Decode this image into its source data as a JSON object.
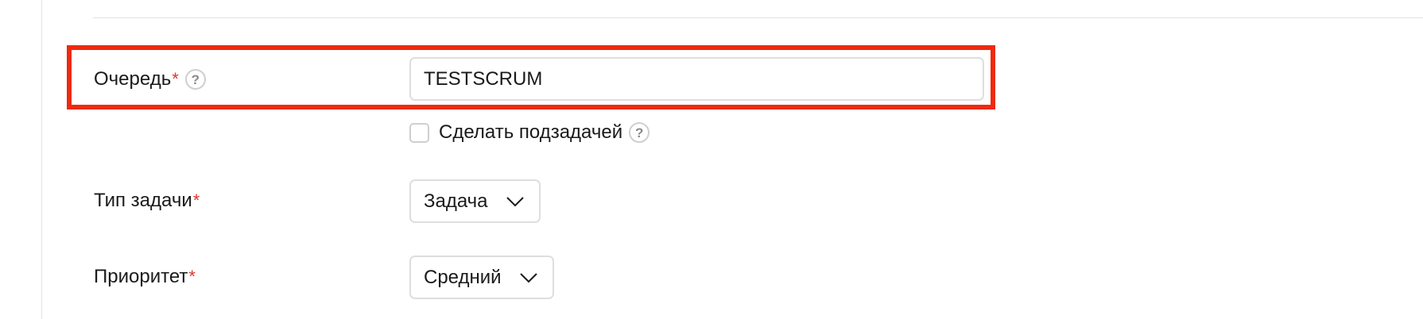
{
  "form": {
    "queue": {
      "label": "Очередь",
      "required_mark": "*",
      "help": "?",
      "value": "TESTSCRUM"
    },
    "subtask": {
      "label": "Сделать подзадачей",
      "help": "?",
      "checked": false
    },
    "task_type": {
      "label": "Тип задачи",
      "required_mark": "*",
      "value": "Задача"
    },
    "priority": {
      "label": "Приоритет",
      "required_mark": "*",
      "value": "Средний"
    }
  },
  "colors": {
    "highlight": "#ee2a0f",
    "required": "#e0352b",
    "border": "#dedede"
  },
  "icons": {
    "help": "question-circle-icon",
    "dropdown": "chevron-down-icon"
  }
}
